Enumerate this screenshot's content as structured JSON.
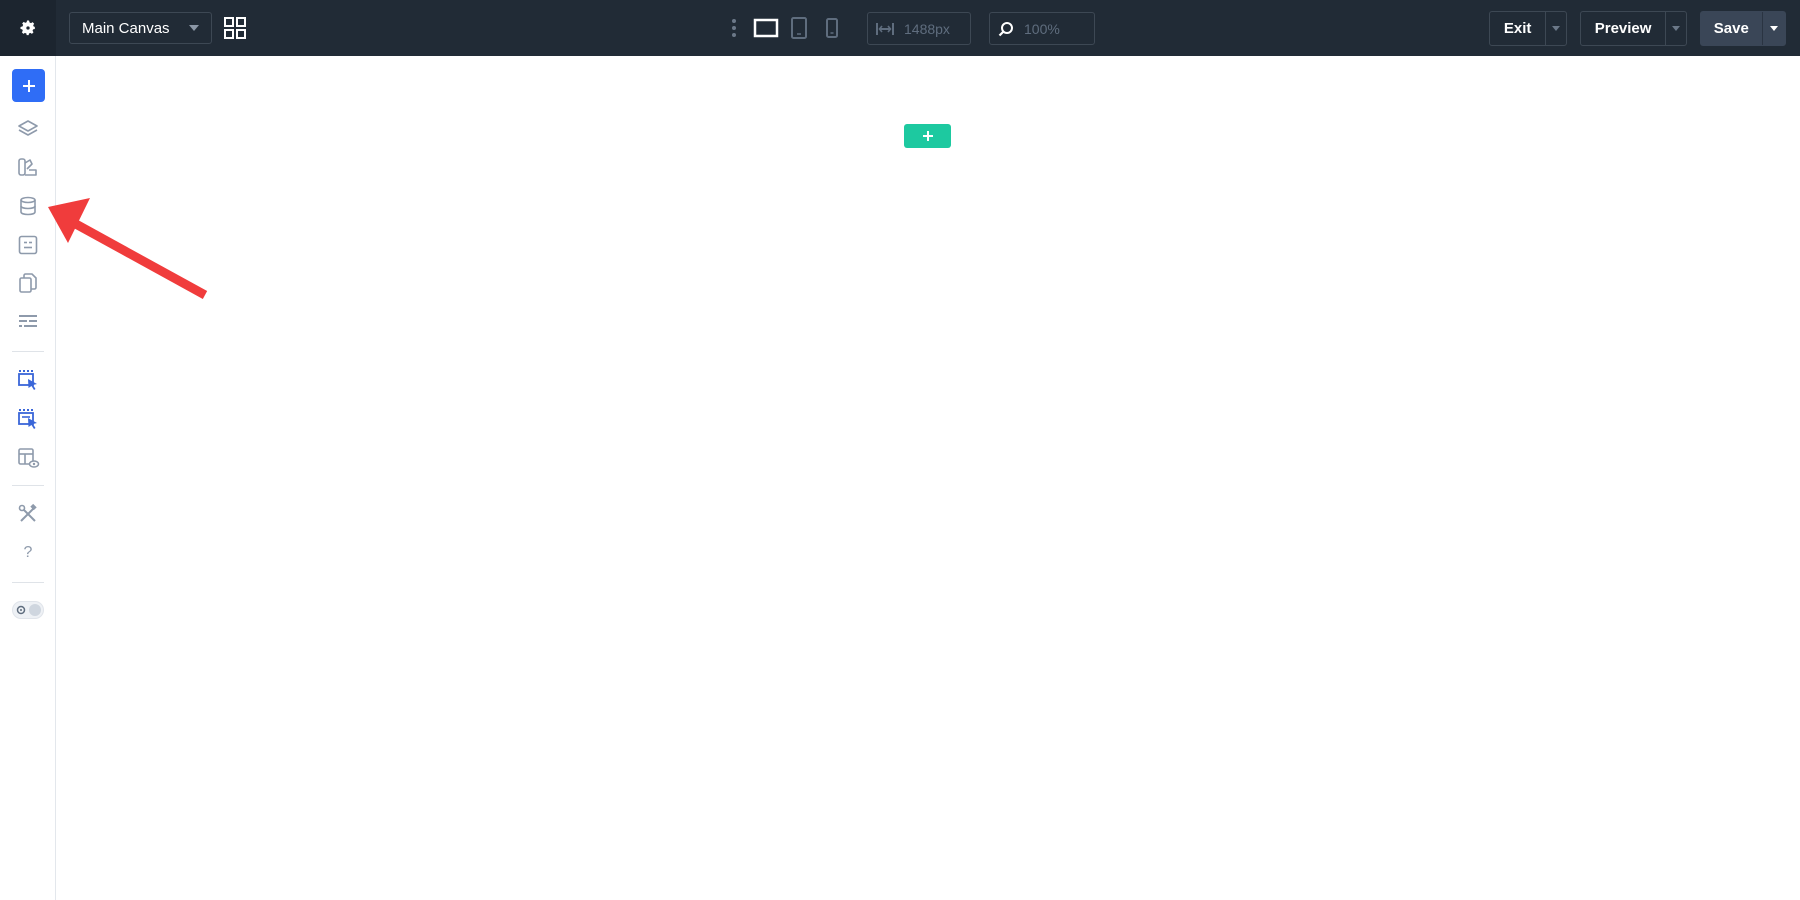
{
  "toolbar": {
    "canvas_select": {
      "value": "Main Canvas"
    },
    "responsive_width": {
      "value": "1488px"
    },
    "zoom": {
      "value": "100%"
    },
    "exit_label": "Exit",
    "preview_label": "Preview",
    "save_label": "Save",
    "active_device": "desktop",
    "icons": [
      "gear-icon",
      "grid-icon",
      "kebab-icon",
      "desktop-icon",
      "tablet-icon",
      "mobile-icon",
      "width-icon",
      "zoom-icon"
    ]
  },
  "sidebar": {
    "help_label": "?",
    "icons": [
      "plus-icon",
      "layers-icon",
      "design-icon",
      "database-icon",
      "content-icon",
      "pages-icon",
      "layout-icon",
      "select-pointer-icon",
      "select-multi-icon",
      "template-preview-icon",
      "tools-icon",
      "help-icon",
      "theme-toggle"
    ]
  },
  "colors": {
    "topbar": "#212b36",
    "accent_blue": "#2f6df6",
    "accent_green": "#1dc9a0",
    "annotation_red": "#f03c3c"
  }
}
